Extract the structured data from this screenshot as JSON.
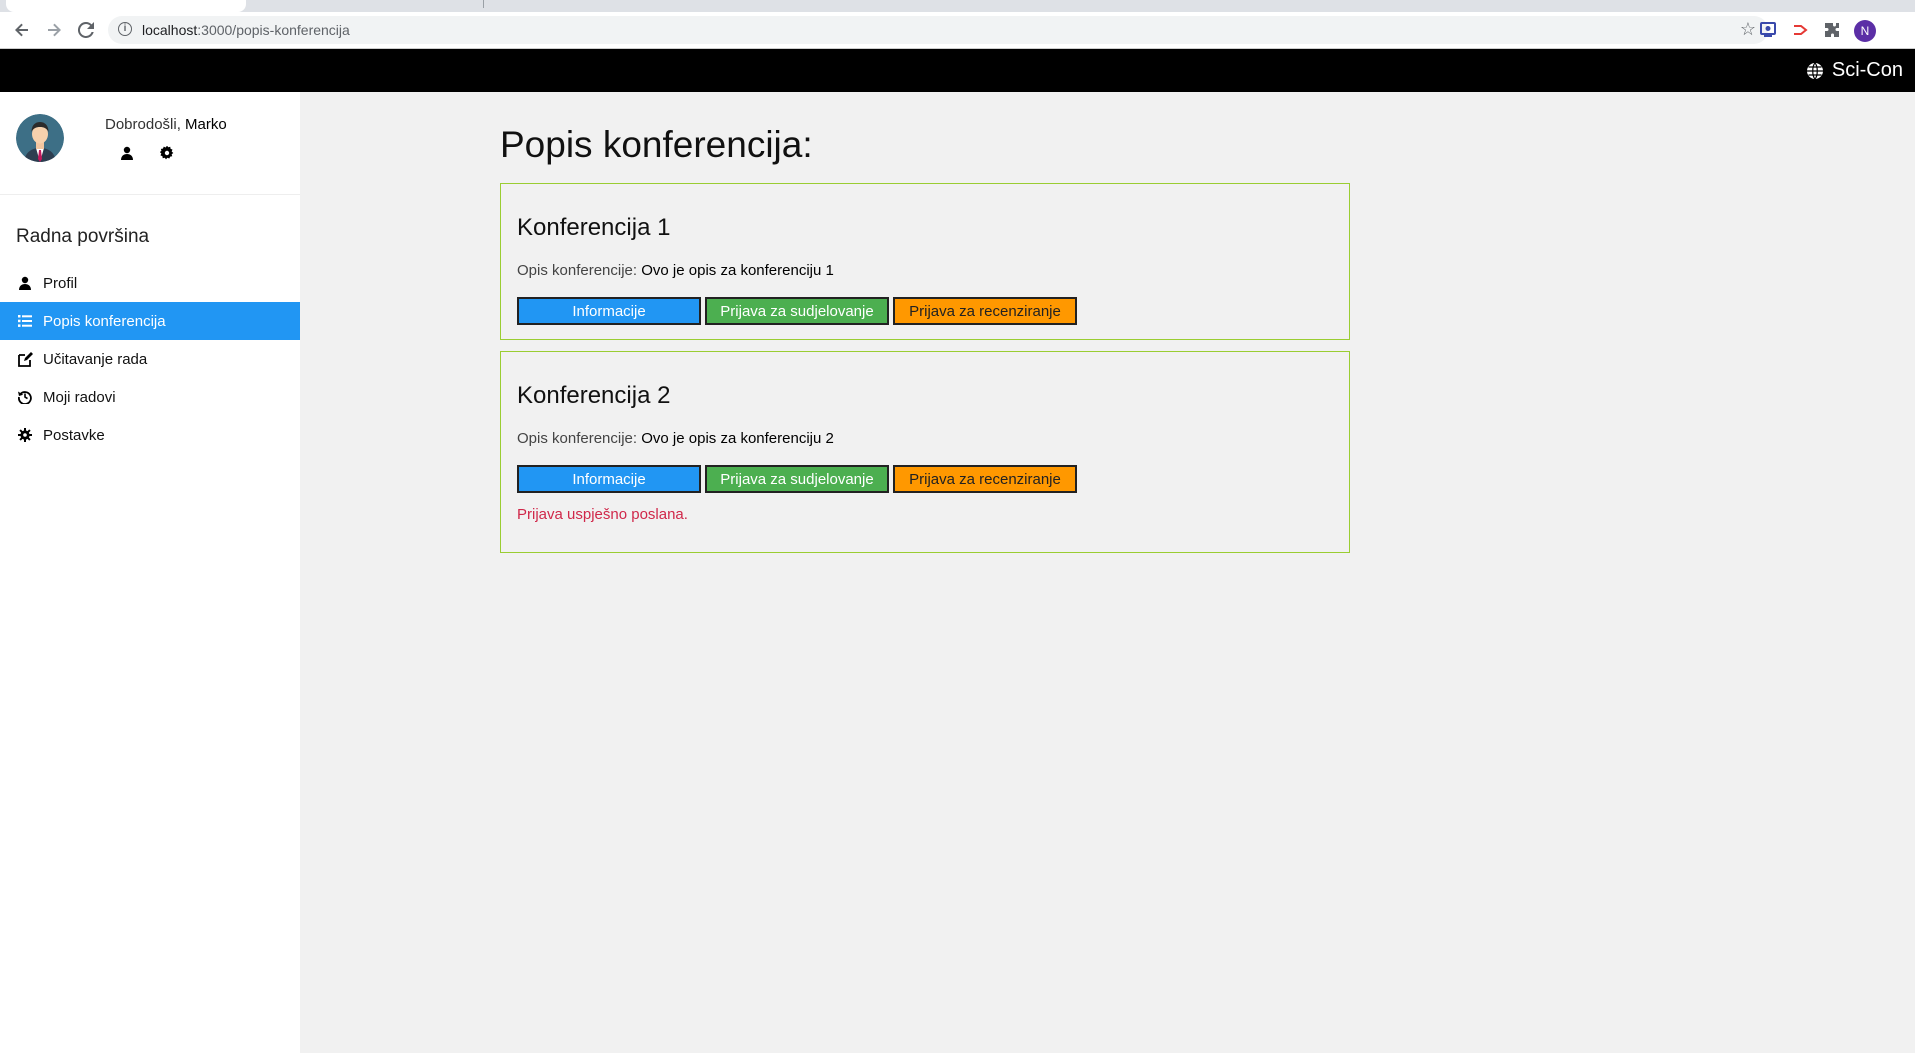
{
  "browser": {
    "url_host": "localhost",
    "url_path": ":3000/popis-konferencija",
    "profile_initial": "N"
  },
  "header": {
    "brand": "Sci-Con",
    "bg_color": "#000000"
  },
  "sidebar": {
    "welcome_prefix": "Dobrodošli, ",
    "user_name": "Marko",
    "workspace_title": "Radna površina",
    "items": [
      {
        "label": "Profil",
        "icon": "user-icon",
        "active": false
      },
      {
        "label": "Popis konferencija",
        "icon": "list-icon",
        "active": true
      },
      {
        "label": "Učitavanje rada",
        "icon": "edit-icon",
        "active": false
      },
      {
        "label": "Moji radovi",
        "icon": "history-icon",
        "active": false
      },
      {
        "label": "Postavke",
        "icon": "gear-icon",
        "active": false
      }
    ],
    "active_color": "#2196f3"
  },
  "main": {
    "title": "Popis konferencija:",
    "desc_label": "Opis konferencije: ",
    "buttons": {
      "info": "Informacije",
      "participate": "Prijava za sudjelovanje",
      "review": "Prijava za recenziranje"
    },
    "conferences": [
      {
        "name": "Konferencija 1",
        "description": "Ovo je opis za konferenciju 1",
        "message": ""
      },
      {
        "name": "Konferencija 2",
        "description": "Ovo je opis za konferenciju 2",
        "message": "Prijava uspješno poslana."
      }
    ],
    "colors": {
      "card_border": "#9acd32",
      "info": "#2196f3",
      "participate": "#4caf50",
      "review": "#ff9800",
      "message": "#d0284a"
    }
  }
}
